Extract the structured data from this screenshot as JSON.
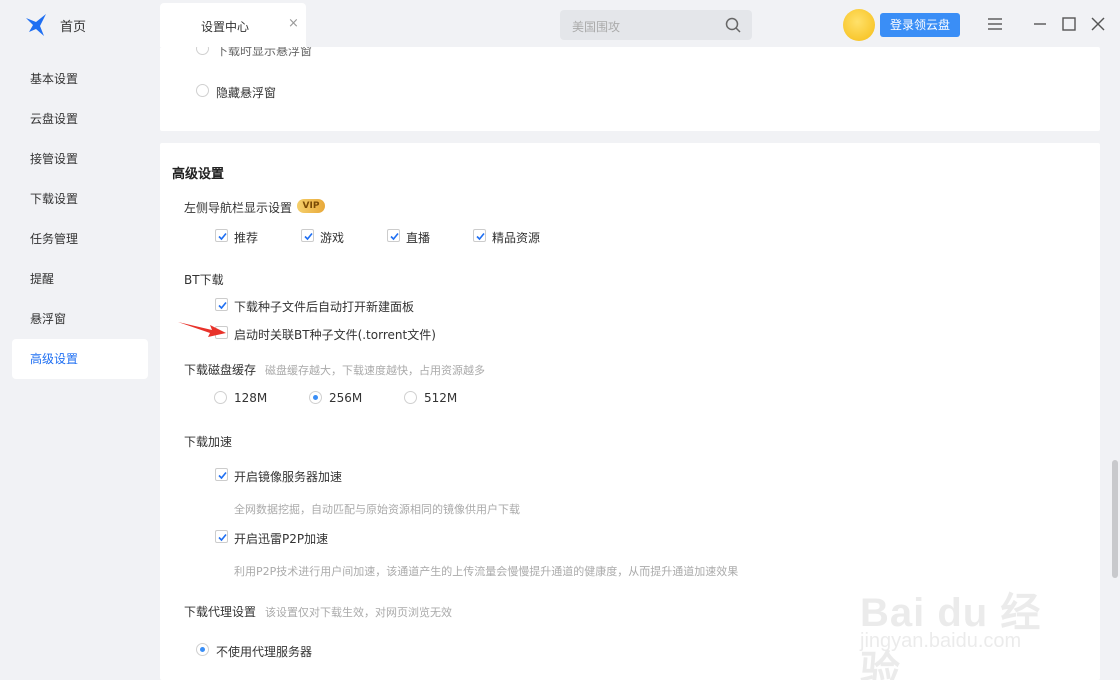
{
  "topbar": {
    "home_label": "首页",
    "tab_label": "设置中心",
    "tab_close": "×",
    "search_placeholder": "美国围攻",
    "login_label": "登录领云盘"
  },
  "sidebar": {
    "items": [
      {
        "label": "基本设置"
      },
      {
        "label": "云盘设置"
      },
      {
        "label": "接管设置"
      },
      {
        "label": "下载设置"
      },
      {
        "label": "任务管理"
      },
      {
        "label": "提醒"
      },
      {
        "label": "悬浮窗"
      },
      {
        "label": "高级设置",
        "active": true
      }
    ]
  },
  "float_window": {
    "option_partial": "下载时显示悬浮窗",
    "option_hide": "隐藏悬浮窗"
  },
  "advanced": {
    "title": "高级设置",
    "nav_display": {
      "label": "左侧导航栏显示设置",
      "badge": "VIP",
      "options": [
        {
          "label": "推荐",
          "checked": true
        },
        {
          "label": "游戏",
          "checked": true
        },
        {
          "label": "直播",
          "checked": true
        },
        {
          "label": "精品资源",
          "checked": true
        }
      ]
    },
    "bt": {
      "label": "BT下载",
      "auto_open": {
        "label": "下载种子文件后自动打开新建面板",
        "checked": true
      },
      "associate": {
        "label": "启动时关联BT种子文件(.torrent文件)",
        "checked": false
      }
    },
    "disk_cache": {
      "label": "下载磁盘缓存",
      "hint": "磁盘缓存越大，下载速度越快，占用资源越多",
      "options": [
        {
          "label": "128M",
          "selected": false
        },
        {
          "label": "256M",
          "selected": true
        },
        {
          "label": "512M",
          "selected": false
        }
      ]
    },
    "accel": {
      "label": "下载加速",
      "mirror": {
        "label": "开启镜像服务器加速",
        "checked": true,
        "desc": "全网数据挖掘，自动匹配与原始资源相同的镜像供用户下载"
      },
      "p2p": {
        "label": "开启迅雷P2P加速",
        "checked": true,
        "desc": "利用P2P技术进行用户间加速，该通道产生的上传流量会慢慢提升通道的健康度，从而提升通道加速效果"
      }
    },
    "proxy": {
      "label": "下载代理设置",
      "hint": "该设置仅对下载生效，对网页浏览无效",
      "option_none": "不使用代理服务器"
    }
  },
  "watermark": {
    "brand": "Bai du 经验",
    "domain": "jingyan.baidu.com"
  },
  "colors": {
    "accent": "#3a8ef6",
    "active_text": "#1f6ff2",
    "page_bg": "#f1f2f5"
  }
}
